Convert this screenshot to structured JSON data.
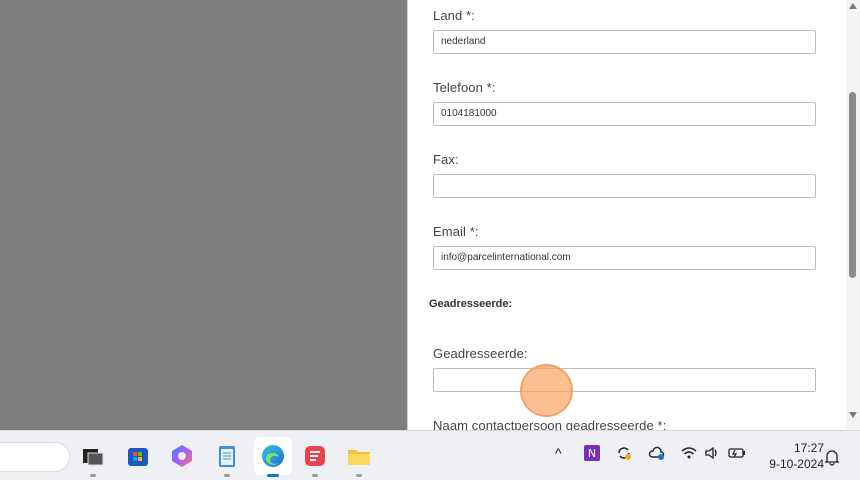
{
  "form": {
    "fields": [
      {
        "label": "Land *:",
        "value": "nederland"
      },
      {
        "label": "Telefoon *:",
        "value": "0104181000"
      },
      {
        "label": "Fax:",
        "value": ""
      },
      {
        "label": "Email *:",
        "value": "info@parcelinternational.com"
      }
    ],
    "section_title": "Geadresseerde:",
    "geadresseerde": {
      "label": "Geadresseerde:",
      "value": ""
    },
    "next_label": "Naam contactpersoon geadresseerde *:"
  },
  "taskbar": {
    "apps": [
      "file-explorer-dark-icon",
      "microsoft-store-icon",
      "copilot-icon",
      "notepad-icon",
      "edge-icon",
      "app-red-icon",
      "folder-icon"
    ],
    "tray": {
      "chevron": "^",
      "onenote": "N"
    },
    "clock": {
      "time": "17:27",
      "date": "9-10-2024"
    }
  },
  "colors": {
    "click_highlight": "#f7a86a",
    "edge_blue": "#1a73c9"
  }
}
